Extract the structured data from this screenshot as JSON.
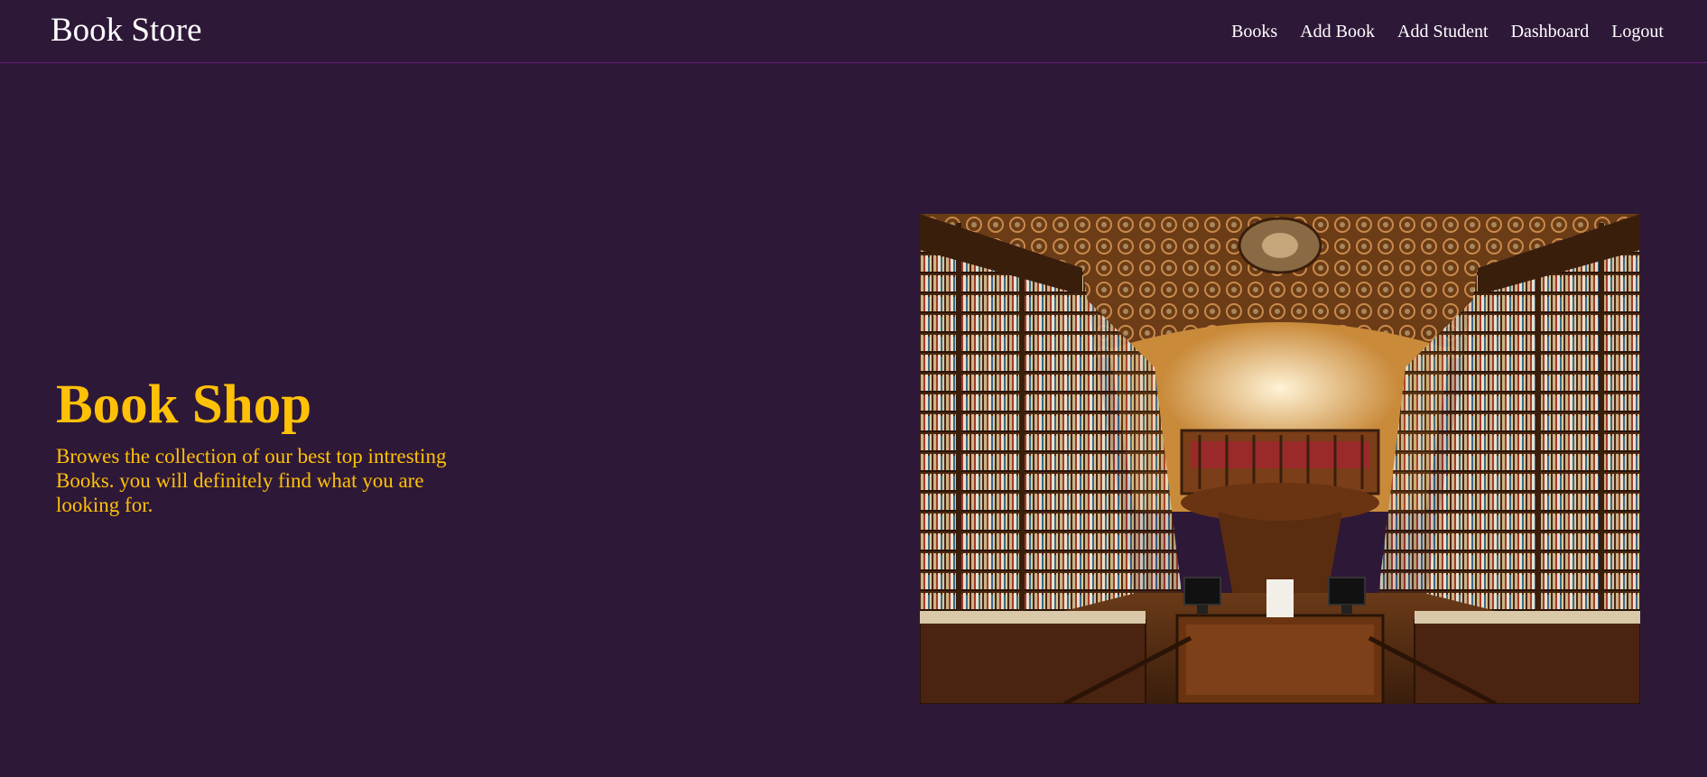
{
  "navbar": {
    "brand": "Book Store",
    "links": [
      {
        "label": "Books"
      },
      {
        "label": "Add Book"
      },
      {
        "label": "Add Student"
      },
      {
        "label": "Dashboard"
      },
      {
        "label": "Logout"
      }
    ]
  },
  "hero": {
    "title": "Book Shop",
    "description": "Browes the collection of our best top intresting Books. you will definitely find what you are looking for."
  },
  "colors": {
    "background": "#2e1838",
    "accent": "#ffc107",
    "nav_text": "#ffffff",
    "nav_border": "#6a1d7a"
  }
}
